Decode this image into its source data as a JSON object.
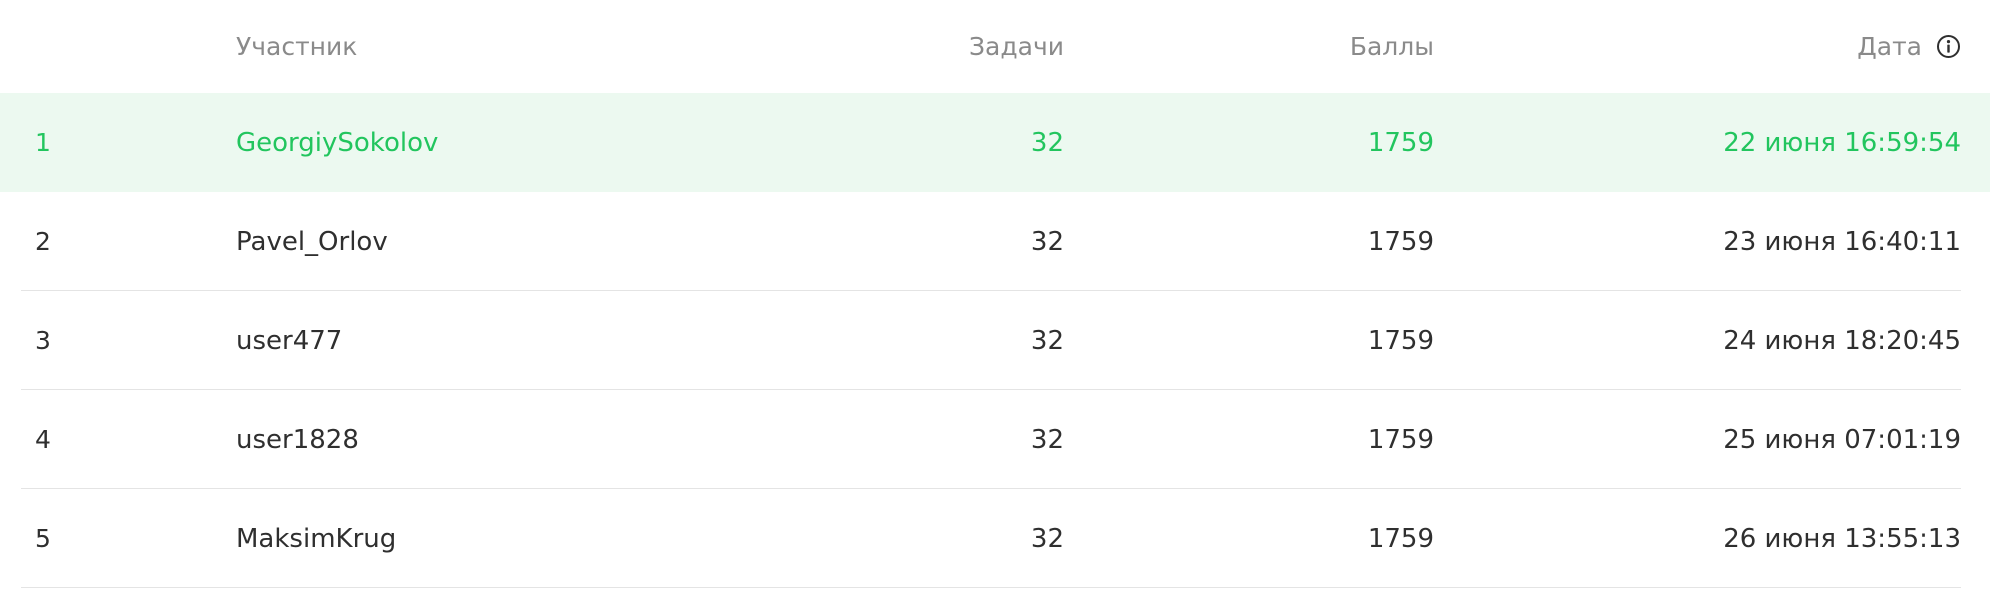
{
  "leaderboard": {
    "columns": {
      "participant": "Участник",
      "tasks": "Задачи",
      "score": "Баллы",
      "date": "Дата"
    },
    "date_info_icon": "info-icon",
    "highlight_color": "#22c55e",
    "highlight_background": "#ecf9f0",
    "rows": [
      {
        "rank": "1",
        "name": "GeorgiySokolov",
        "tasks": "32",
        "score": "1759",
        "date": "22 июня 16:59:54"
      },
      {
        "rank": "2",
        "name": "Pavel_Orlov",
        "tasks": "32",
        "score": "1759",
        "date": "23 июня 16:40:11"
      },
      {
        "rank": "3",
        "name": "user477",
        "tasks": "32",
        "score": "1759",
        "date": "24 июня 18:20:45"
      },
      {
        "rank": "4",
        "name": "user1828",
        "tasks": "32",
        "score": "1759",
        "date": "25 июня 07:01:19"
      },
      {
        "rank": "5",
        "name": "MaksimKrug",
        "tasks": "32",
        "score": "1759",
        "date": "26 июня 13:55:13"
      }
    ]
  }
}
